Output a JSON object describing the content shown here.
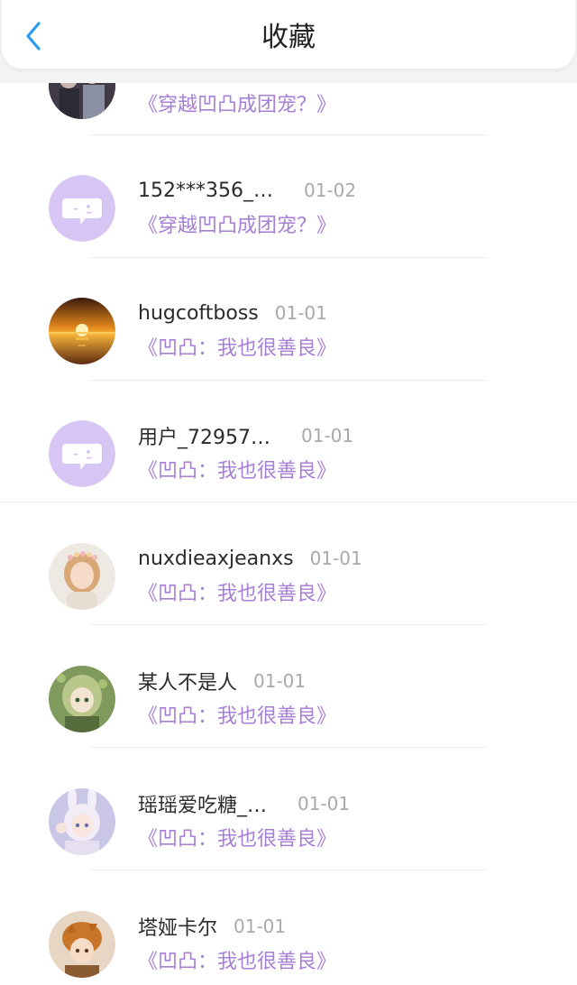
{
  "header": {
    "title": "收藏",
    "back_icon": "chevron-left-icon"
  },
  "colors": {
    "accent": "#2b9cf0",
    "book_title": "#a77fd6",
    "default_avatar": "#d7c6f4"
  },
  "items": [
    {
      "user": "",
      "date": "",
      "book": "《穿越凹凸成团宠？》",
      "avatar": "photo-group-avatar"
    },
    {
      "user": "152***356_…",
      "date": "01-02",
      "book": "《穿越凹凸成团宠？》",
      "avatar": "default-chat-avatar"
    },
    {
      "user": "hugcoftboss",
      "date": "01-01",
      "book": "《凹凸：我也很善良》",
      "avatar": "sunset-avatar"
    },
    {
      "user": "用户_72957…",
      "date": "01-01",
      "book": "《凹凸：我也很善良》",
      "avatar": "default-chat-avatar"
    },
    {
      "user": "nuxdieaxjeanxs",
      "date": "01-01",
      "book": "《凹凸：我也很善良》",
      "avatar": "girl-portrait-avatar"
    },
    {
      "user": "某人不是人",
      "date": "01-01",
      "book": "《凹凸：我也很善良》",
      "avatar": "anime-green-avatar"
    },
    {
      "user": "瑶瑶爱吃糖_…",
      "date": "01-01",
      "book": "《凹凸：我也很善良》",
      "avatar": "anime-bunny-avatar"
    },
    {
      "user": "塔娅卡尔",
      "date": "01-01",
      "book": "《凹凸：我也很善良》",
      "avatar": "anime-tiger-avatar"
    }
  ]
}
